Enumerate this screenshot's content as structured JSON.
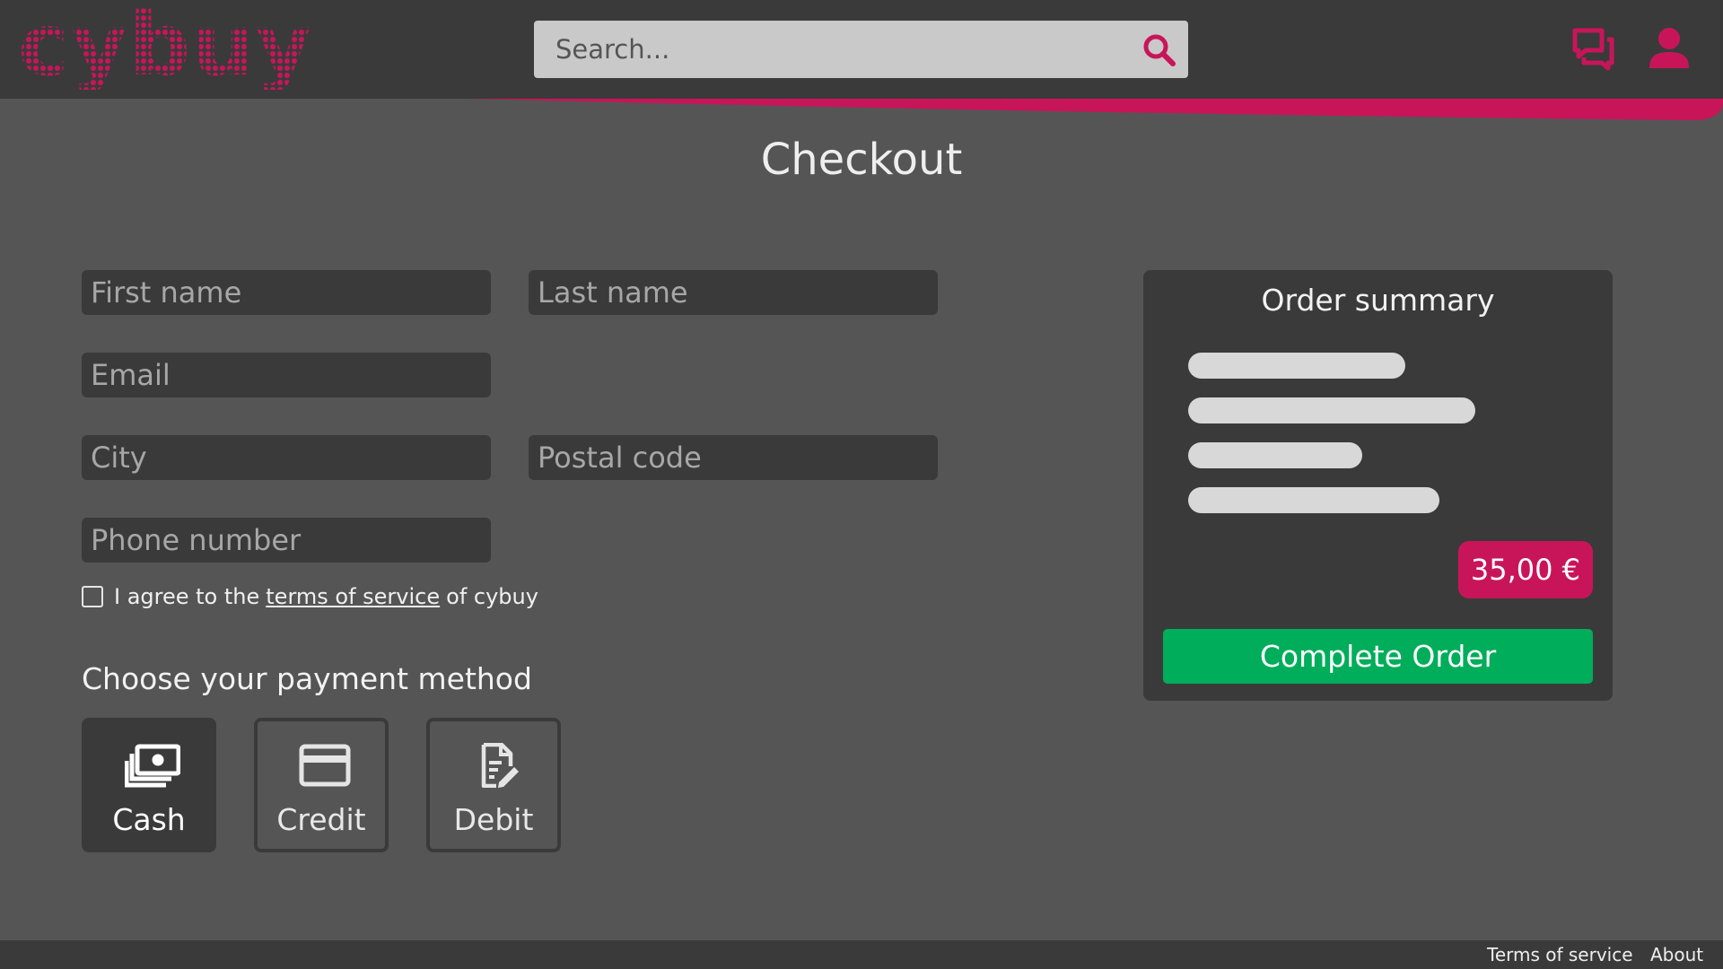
{
  "header": {
    "logo": "cybuy",
    "search_placeholder": "Search...",
    "icons": [
      "search-icon",
      "chat-icon",
      "user-icon"
    ],
    "accent_color": "#c8155a"
  },
  "page": {
    "title": "Checkout"
  },
  "form": {
    "first_name_placeholder": "First name",
    "last_name_placeholder": "Last name",
    "email_placeholder": "Email",
    "city_placeholder": "City",
    "postal_code_placeholder": "Postal code",
    "phone_placeholder": "Phone number",
    "agree_prefix": "I agree to the",
    "agree_link": "terms of service",
    "agree_suffix": "of cybuy",
    "agree_checked": false
  },
  "payment": {
    "heading": "Choose your payment method",
    "options": [
      {
        "label": "Cash",
        "icon": "cash-icon",
        "selected": true
      },
      {
        "label": "Credit",
        "icon": "credit-card-icon",
        "selected": false
      },
      {
        "label": "Debit",
        "icon": "debit-document-icon",
        "selected": false
      }
    ]
  },
  "summary": {
    "title": "Order summary",
    "price": "35,00 €",
    "complete_label": "Complete Order",
    "complete_color": "#00ad5a"
  },
  "footer": {
    "links": [
      "Terms of service",
      "About"
    ]
  }
}
